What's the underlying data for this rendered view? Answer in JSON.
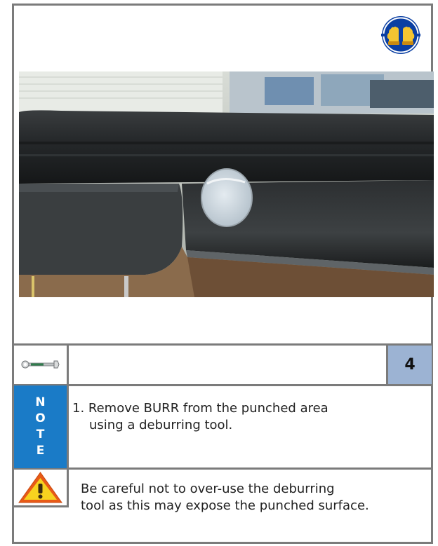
{
  "page": {
    "step_number": "4",
    "note_letters": [
      "N",
      "O",
      "T",
      "E"
    ],
    "note_lines": [
      "1. Remove BURR from the punched area",
      "using a deburring tool."
    ],
    "caution_lines": [
      "Be careful not to over-use the deburring",
      "tool as this may expose the punched surface."
    ]
  },
  "icons": {
    "ppe": "safety-gloves-icon",
    "tool": "wrench-icon",
    "caution": "warning-triangle-icon"
  },
  "colors": {
    "ppe_blue": "#0a3fa3",
    "note_blue": "#1a7bc7",
    "step_bg": "#9cb3d3",
    "warning_orange": "#e85a17",
    "warning_yellow": "#f7d21f",
    "border": "#7b7b7b"
  }
}
